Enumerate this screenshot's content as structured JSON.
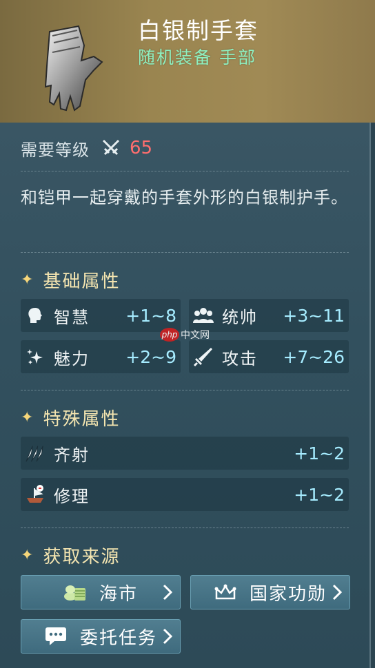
{
  "item": {
    "title": "白银制手套",
    "subtitle": "随机装备 手部"
  },
  "requirement": {
    "label": "需要等级",
    "icon": "crossed-swords-icon",
    "level": "65"
  },
  "description": "和铠甲一起穿戴的手套外形的白银制护手。",
  "basic_attributes": {
    "title": "基础属性",
    "stats": [
      {
        "name": "智慧",
        "value": "+1~8",
        "icon": "head-icon"
      },
      {
        "name": "统帅",
        "value": "+3~11",
        "icon": "group-icon"
      },
      {
        "name": "魅力",
        "value": "+2~9",
        "icon": "sparkle-icon"
      },
      {
        "name": "攻击",
        "value": "+7~26",
        "icon": "sword-icon"
      }
    ]
  },
  "special_attributes": {
    "title": "特殊属性",
    "stats": [
      {
        "name": "齐射",
        "value": "+1~2",
        "icon": "volley-icon"
      },
      {
        "name": "修理",
        "value": "+1~2",
        "icon": "ship-repair-icon"
      }
    ]
  },
  "sources": {
    "title": "获取来源",
    "buttons": [
      {
        "label": "海市",
        "icon": "coins-icon"
      },
      {
        "label": "国家功勋",
        "icon": "crown-icon"
      },
      {
        "label": "委托任务",
        "icon": "chat-icon"
      }
    ]
  },
  "watermark": {
    "badge": "php",
    "text": "中文网"
  },
  "colors": {
    "panel": "#32505e",
    "header": "#9a8550",
    "subtitle": "#8ff0c0",
    "level": "#ff6e6e",
    "stat_value": "#a6ecff",
    "section_title": "#f4e5b0"
  }
}
